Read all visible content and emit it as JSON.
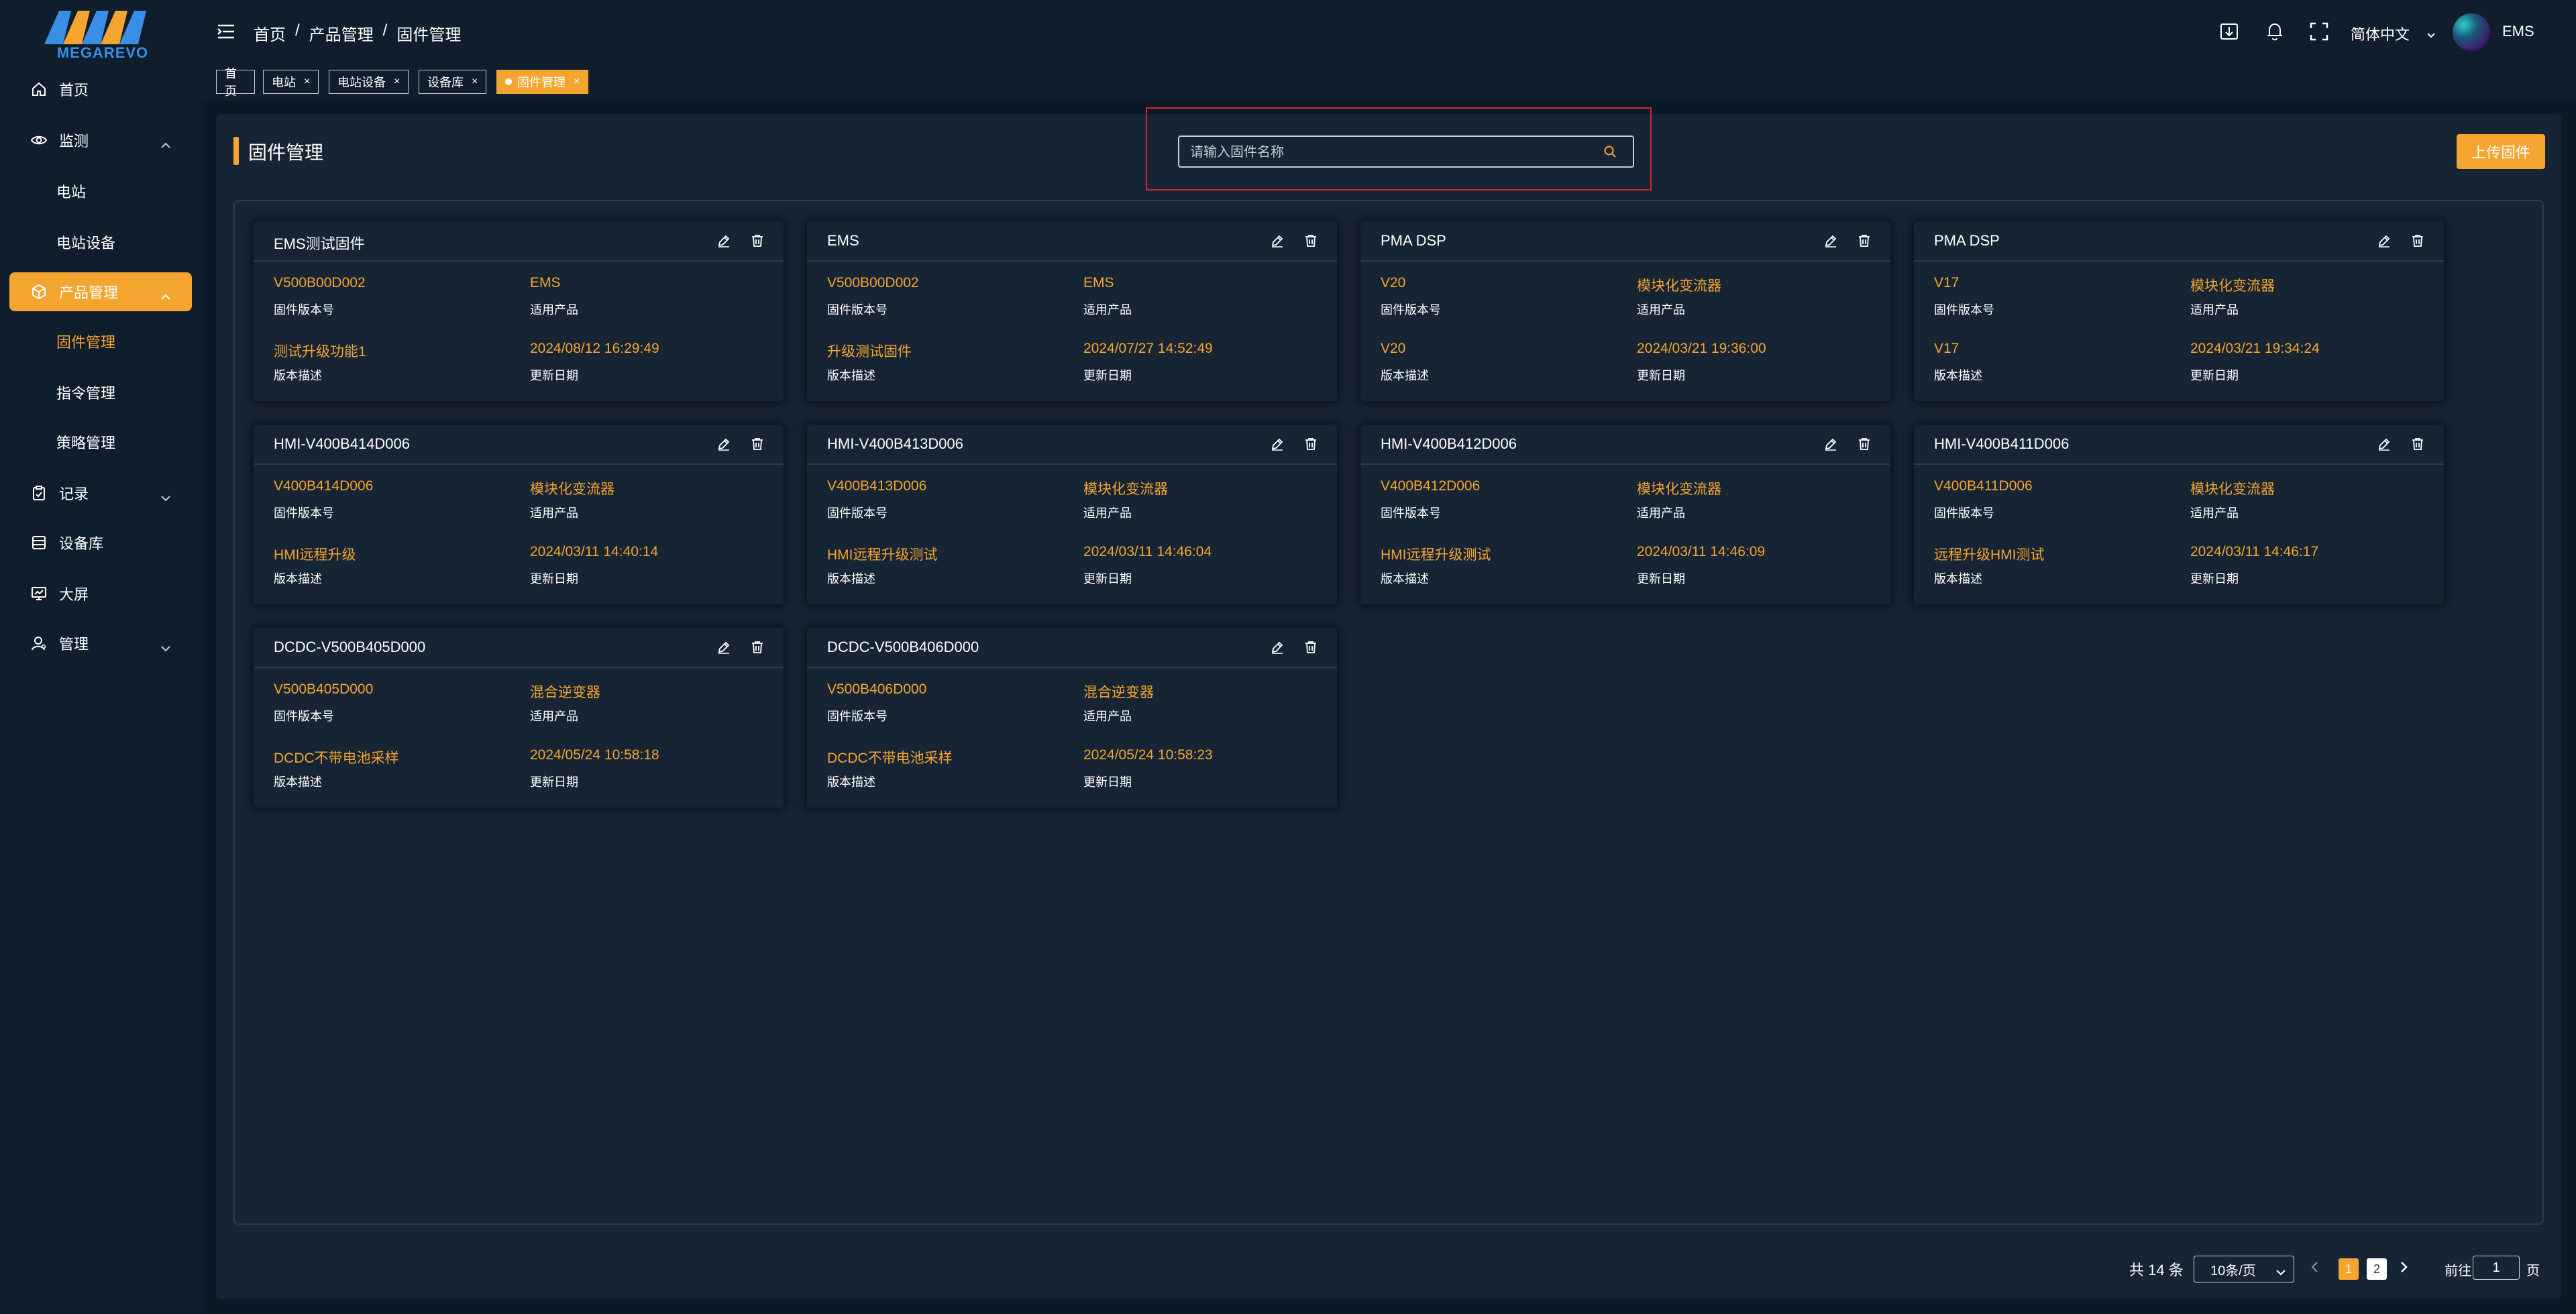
{
  "logo": {
    "text": "MEGAREVO"
  },
  "sidebar": {
    "items": [
      {
        "label": "首页",
        "icon": "home-icon"
      },
      {
        "label": "监测",
        "icon": "eye-icon",
        "children": [
          "电站",
          "电站设备"
        ]
      },
      {
        "label": "产品管理",
        "icon": "box-icon",
        "active": true,
        "children": [
          "固件管理",
          "指令管理",
          "策略管理"
        ],
        "active_child": "固件管理"
      },
      {
        "label": "记录",
        "icon": "clipboard-icon"
      },
      {
        "label": "设备库",
        "icon": "list-icon"
      },
      {
        "label": "大屏",
        "icon": "monitor-icon"
      },
      {
        "label": "管理",
        "icon": "user-icon"
      }
    ]
  },
  "header": {
    "breadcrumb": [
      "首页",
      "产品管理",
      "固件管理"
    ],
    "breadcrumb_sep": "/",
    "language": "简体中文",
    "username": "EMS"
  },
  "tabs": [
    {
      "label": "首页",
      "closable": false
    },
    {
      "label": "电站",
      "closable": true
    },
    {
      "label": "电站设备",
      "closable": true
    },
    {
      "label": "设备库",
      "closable": true
    },
    {
      "label": "固件管理",
      "closable": true,
      "active": true
    }
  ],
  "tab_close": "×",
  "page": {
    "title": "固件管理",
    "search_placeholder": "请输入固件名称",
    "upload_label": "上传固件"
  },
  "card_labels": {
    "version": "固件版本号",
    "product": "适用产品",
    "desc": "版本描述",
    "date": "更新日期"
  },
  "cards": [
    {
      "title": "EMS测试固件",
      "version": "V500B00D002",
      "product": "EMS",
      "desc": "测试升级功能1",
      "date": "2024/08/12 16:29:49"
    },
    {
      "title": "EMS",
      "version": "V500B00D002",
      "product": "EMS",
      "desc": "升级测试固件",
      "date": "2024/07/27 14:52:49"
    },
    {
      "title": "PMA DSP",
      "version": "V20",
      "product": "模块化变流器",
      "desc": "V20",
      "date": "2024/03/21 19:36:00"
    },
    {
      "title": "PMA DSP",
      "version": "V17",
      "product": "模块化变流器",
      "desc": "V17",
      "date": "2024/03/21 19:34:24"
    },
    {
      "title": "HMI-V400B414D006",
      "version": "V400B414D006",
      "product": "模块化变流器",
      "desc": "HMI远程升级",
      "date": "2024/03/11 14:40:14"
    },
    {
      "title": "HMI-V400B413D006",
      "version": "V400B413D006",
      "product": "模块化变流器",
      "desc": "HMI远程升级测试",
      "date": "2024/03/11 14:46:04"
    },
    {
      "title": "HMI-V400B412D006",
      "version": "V400B412D006",
      "product": "模块化变流器",
      "desc": "HMI远程升级测试",
      "date": "2024/03/11 14:46:09"
    },
    {
      "title": "HMI-V400B411D006",
      "version": "V400B411D006",
      "product": "模块化变流器",
      "desc": "远程升级HMI测试",
      "date": "2024/03/11 14:46:17"
    },
    {
      "title": "DCDC-V500B405D000",
      "version": "V500B405D000",
      "product": "混合逆变器",
      "desc": "DCDC不带电池采样",
      "date": "2024/05/24 10:58:18"
    },
    {
      "title": "DCDC-V500B406D000",
      "version": "V500B406D000",
      "product": "混合逆变器",
      "desc": "DCDC不带电池采样",
      "date": "2024/05/24 10:58:23"
    }
  ],
  "pagination": {
    "total_text": "共 14 条",
    "page_size": "10条/页",
    "pages": [
      "1",
      "2"
    ],
    "current_page": "1",
    "goto_label": "前往",
    "goto_value": "1",
    "goto_unit": "页"
  },
  "colors": {
    "accent": "#f4a52f",
    "background": "#0b1826",
    "panel": "#172434",
    "highlight_border": "#d3262b"
  }
}
